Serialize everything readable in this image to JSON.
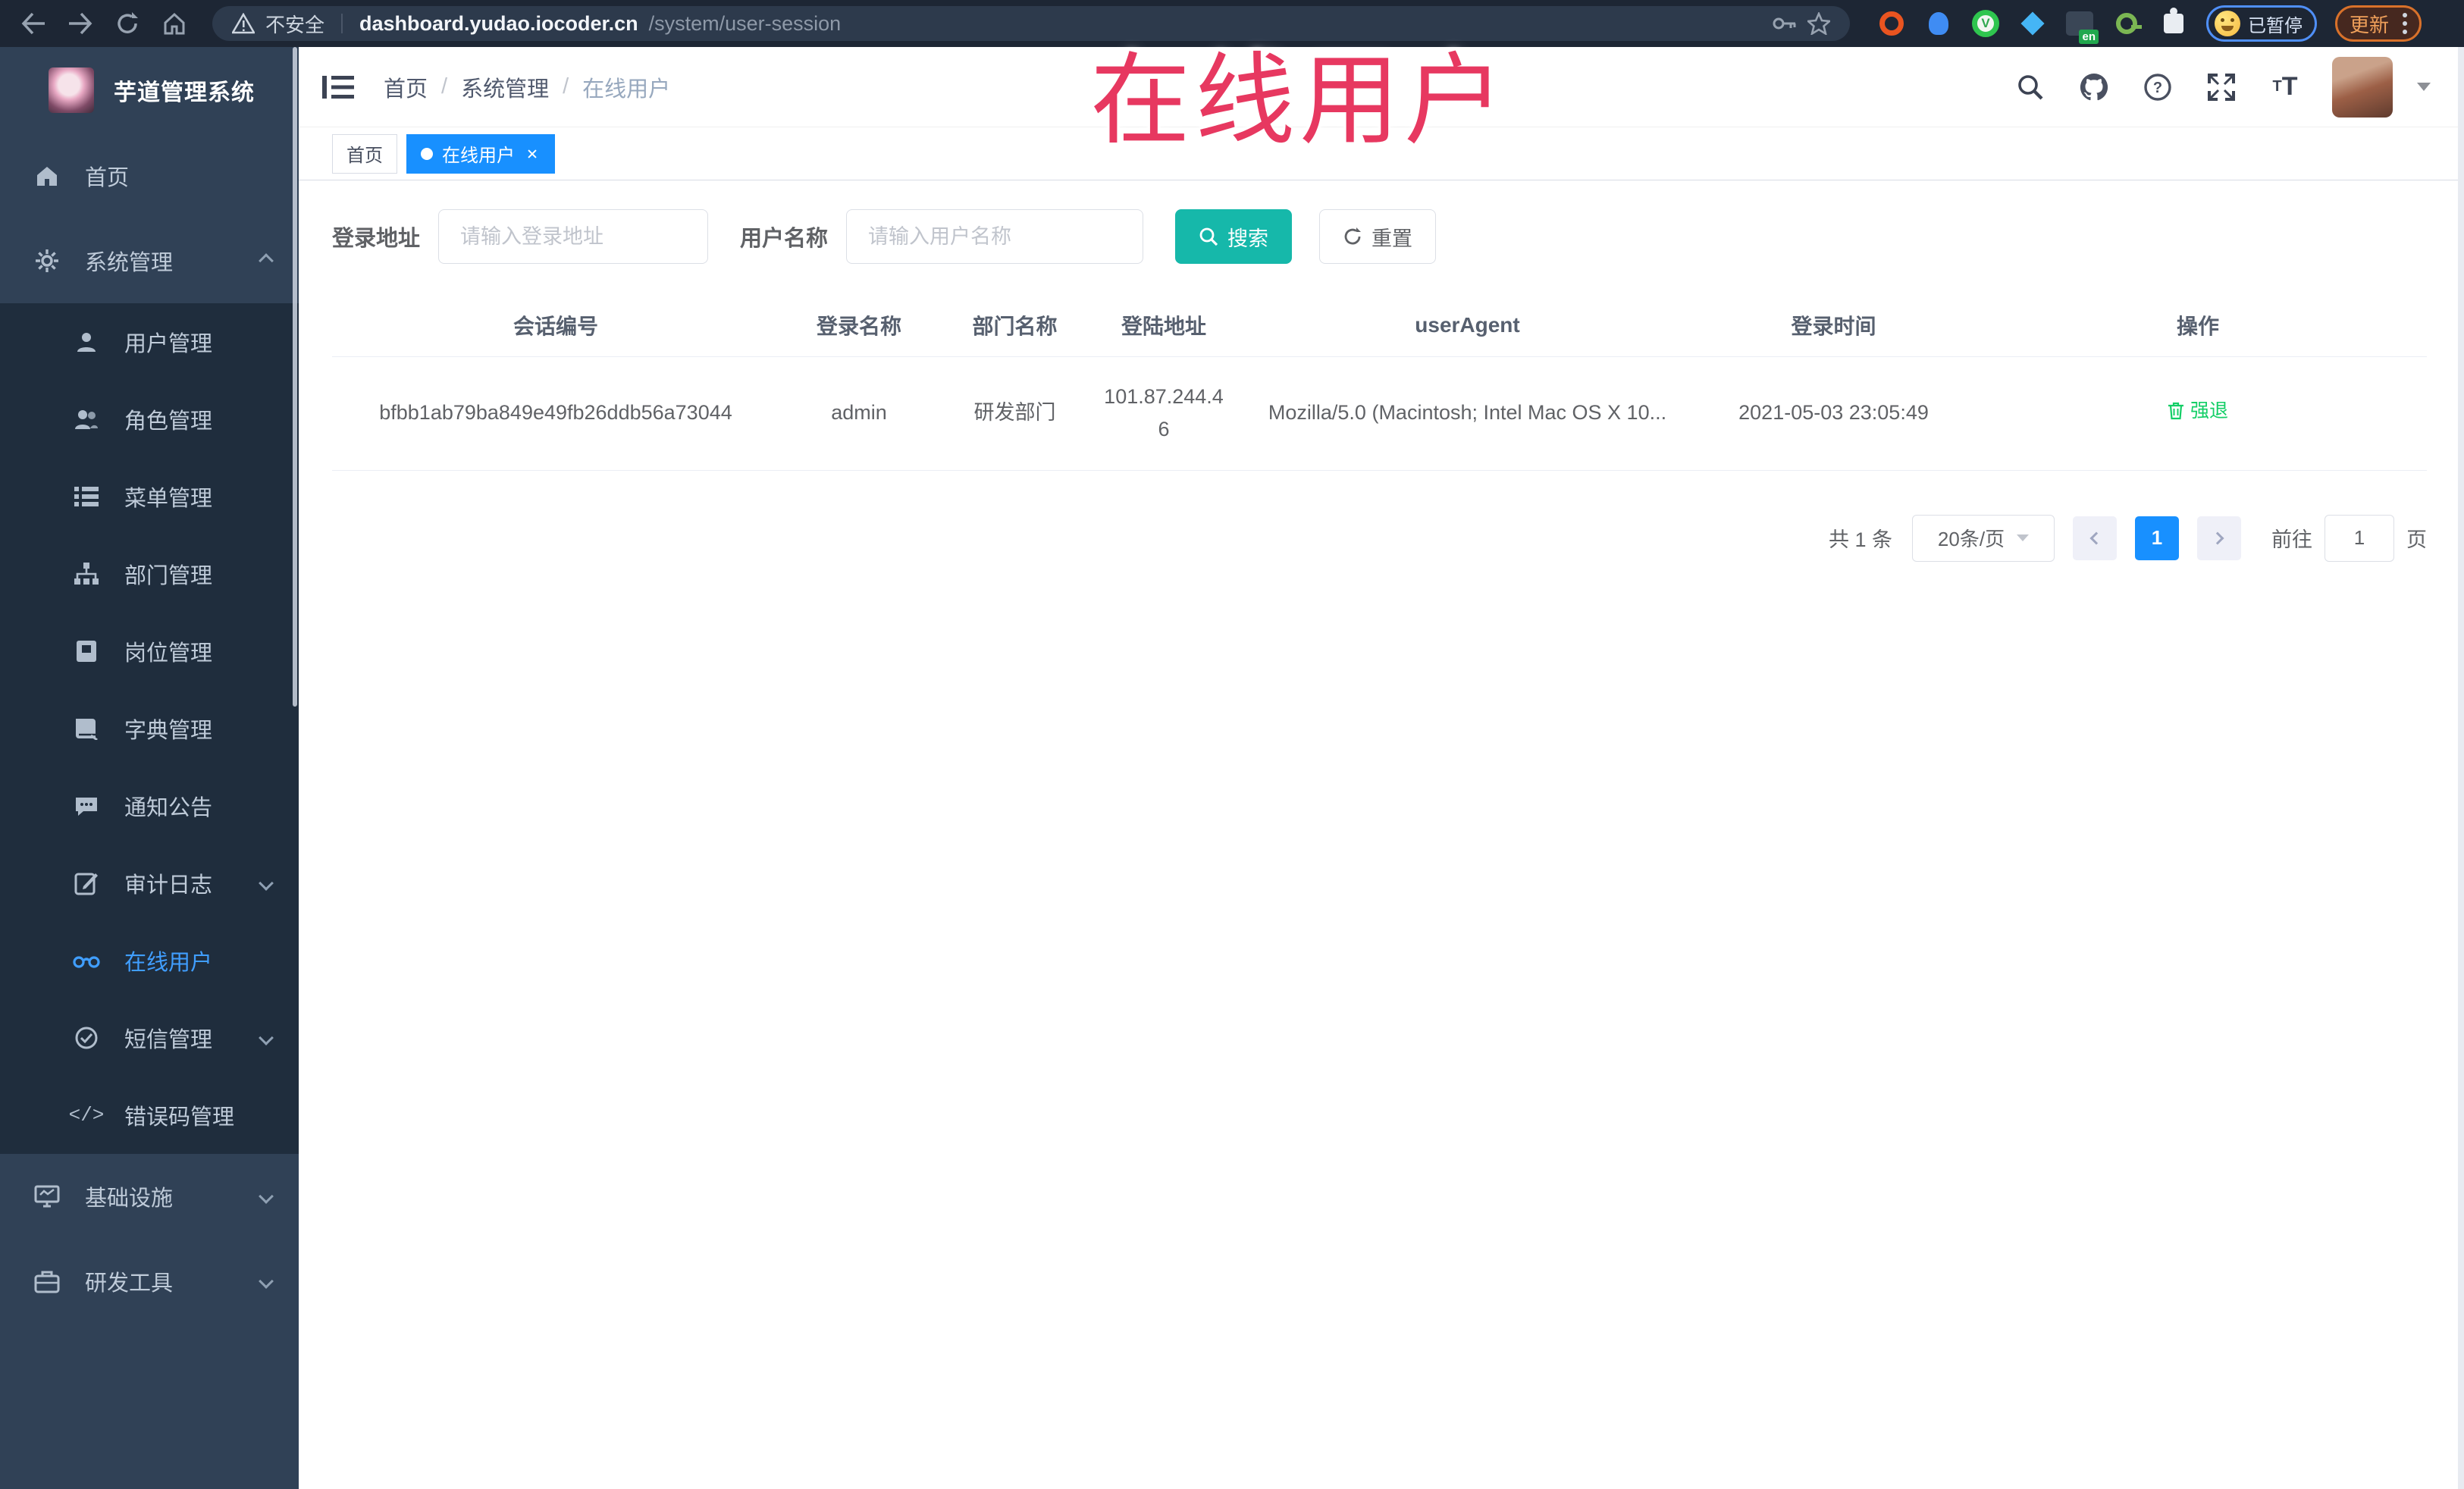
{
  "browser": {
    "security_label": "不安全",
    "url_host": "dashboard.yudao.iocoder.cn",
    "url_path": "/system/user-session",
    "extension_en_badge": "en",
    "paused_label": "已暂停",
    "update_label": "更新"
  },
  "annotation": {
    "text": "在线用户",
    "color": "#e73860"
  },
  "sidebar": {
    "title": "芋道管理系统",
    "items": [
      {
        "label": "首页"
      },
      {
        "label": "系统管理"
      },
      {
        "label": "用户管理"
      },
      {
        "label": "角色管理"
      },
      {
        "label": "菜单管理"
      },
      {
        "label": "部门管理"
      },
      {
        "label": "岗位管理"
      },
      {
        "label": "字典管理"
      },
      {
        "label": "通知公告"
      },
      {
        "label": "审计日志"
      },
      {
        "label": "在线用户"
      },
      {
        "label": "短信管理"
      },
      {
        "label": "错误码管理"
      },
      {
        "label": "基础设施"
      },
      {
        "label": "研发工具"
      }
    ]
  },
  "breadcrumb": {
    "items": [
      "首页",
      "系统管理",
      "在线用户"
    ],
    "separator": "/"
  },
  "tabs": [
    {
      "label": "首页"
    },
    {
      "label": "在线用户"
    }
  ],
  "filters": {
    "address_label": "登录地址",
    "address_placeholder": "请输入登录地址",
    "username_label": "用户名称",
    "username_placeholder": "请输入用户名称",
    "search_label": "搜索",
    "reset_label": "重置"
  },
  "table": {
    "headers": [
      "会话编号",
      "登录名称",
      "部门名称",
      "登陆地址",
      "userAgent",
      "登录时间",
      "操作"
    ],
    "rows": [
      {
        "session_id": "bfbb1ab79ba849e49fb26ddb56a73044",
        "username": "admin",
        "department": "研发部门",
        "login_address": "101.87.244.46",
        "user_agent": "Mozilla/5.0 (Macintosh; Intel Mac OS X 10...",
        "login_time": "2021-05-03 23:05:49",
        "action": "强退"
      }
    ]
  },
  "pagination": {
    "total_label": "共 1 条",
    "page_size": "20条/页",
    "current_page": "1",
    "goto_label": "前往",
    "goto_value": "1",
    "page_label": "页"
  },
  "colors": {
    "primary_blue": "#1890ff",
    "link_blue": "#409eff",
    "sidebar_bg": "#304156",
    "submenu_bg": "#1f2d3d",
    "search_teal": "#16b8aa",
    "action_green": "#13ce66",
    "annotation_red": "#e73860",
    "toolbar_dark": "#1d2634"
  }
}
